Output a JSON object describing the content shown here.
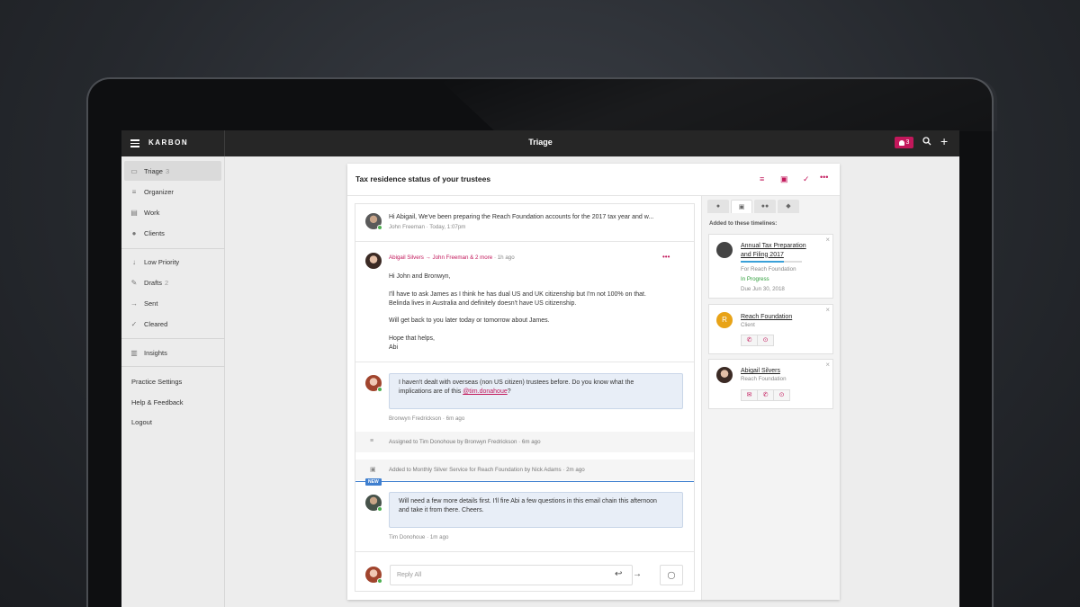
{
  "app": {
    "brand": "KARBON",
    "view_title": "Triage",
    "notification_count": "3"
  },
  "sidebar": {
    "items": [
      {
        "label": "Triage",
        "count": "3"
      },
      {
        "label": "Organizer",
        "count": ""
      },
      {
        "label": "Work",
        "count": ""
      },
      {
        "label": "Clients",
        "count": ""
      },
      {
        "label": "Low Priority",
        "count": ""
      },
      {
        "label": "Drafts",
        "count": "2"
      },
      {
        "label": "Sent",
        "count": ""
      },
      {
        "label": "Cleared",
        "count": ""
      },
      {
        "label": "Insights",
        "count": ""
      }
    ],
    "footer": [
      "Practice Settings",
      "Help & Feedback",
      "Logout"
    ]
  },
  "conversation": {
    "title": "Tax residence status of your trustees",
    "first_message": {
      "preview": "Hi Abigail, We've been preparing the Reach Foundation accounts for the 2017 tax year and w...",
      "author": "John Freeman",
      "time": "Today, 1:07pm"
    },
    "abi_message": {
      "from": "Abigail Silvers",
      "to": "John Freeman & 2 more",
      "time": "1h ago",
      "greeting": "Hi John and Bronwyn,",
      "para1_line1": "I'll have to ask James as I think he has dual US and UK citizenship but I'm not 100% on that.",
      "para1_line2": "Belinda lives in Australia and definitely doesn't have US citizenship.",
      "para2": "Will get back to you later today or tomorrow about James.",
      "signoff": "Hope that helps,",
      "signature": "Abi"
    },
    "bronwyn_comment": {
      "line1": "I haven't dealt with overseas (non US citizen) trustees before. Do you know what the",
      "line2_prefix": "implications are of this ",
      "mention": "@tim.donahoue",
      "line2_suffix": "?",
      "author": "Bronwyn Fredrickson",
      "time": "6m ago"
    },
    "activity_1": {
      "text": "Assigned to Tim Donohoue by Bronwyn Fredrickson",
      "time": "6m ago"
    },
    "activity_2": {
      "text": "Added to Monthly Silver Service for Reach Foundation by Nick Adams",
      "time": "2m ago"
    },
    "new_label": "NEW",
    "tim_comment": {
      "line1": "Will need a few more details first. I'll fire Abi a few questions in this email chain this afternoon",
      "line2": "and take it from there. Cheers.",
      "author": "Tim Donohoue",
      "time": "1m ago"
    },
    "reply_placeholder": "Reply All"
  },
  "side_panel": {
    "label": "Added to these timelines:",
    "timeline_card": {
      "title_line1": "Annual Tax Preparation",
      "title_line2": "and Filing 2017",
      "for": "For Reach Foundation",
      "status": "In Progress",
      "due": "Due Jun 30, 2018",
      "progress": 0.7
    },
    "client_card": {
      "initial": "R",
      "name": "Reach Foundation",
      "type": "Client"
    },
    "contact_card": {
      "name": "Abigail Silvers",
      "org": "Reach Foundation"
    }
  },
  "colors": {
    "accent": "#c2185b",
    "topbar": "#262626",
    "new_line": "#3f7fcf",
    "status_green": "#2e9e3a"
  }
}
